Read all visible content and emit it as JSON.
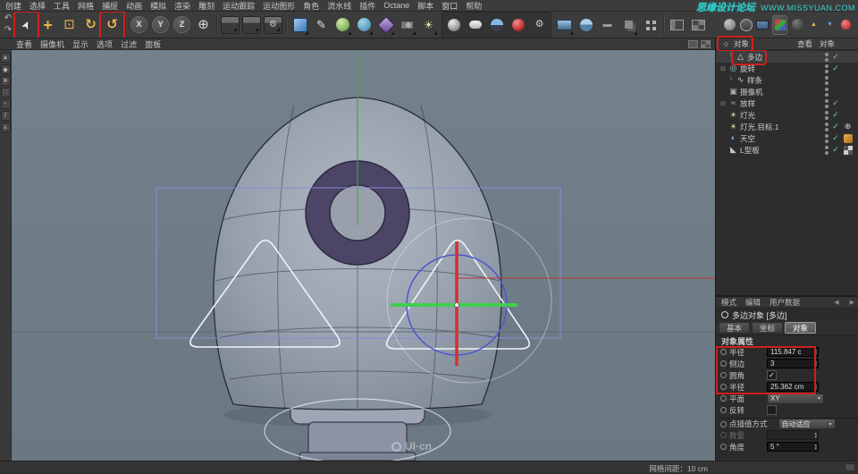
{
  "watermarks": {
    "forum": "思缘设计论坛",
    "url": "WWW.MISSYUAN.COM",
    "ui_logo": "UI·cn"
  },
  "menubar": {
    "items": [
      "创建",
      "选择",
      "工具",
      "网格",
      "捕捉",
      "动画",
      "模拟",
      "渲染",
      "雕刻",
      "运动跟踪",
      "运动图形",
      "角色",
      "流水线",
      "插件",
      "Octane",
      "脚本",
      "窗口",
      "帮助"
    ]
  },
  "toolbar": {
    "history": [
      {
        "n": "undo-icon"
      },
      {
        "n": "redo-icon"
      }
    ],
    "tools": [
      {
        "n": "live-selection-tool-icon",
        "boxed": true
      },
      {
        "n": "move-tool-icon"
      },
      {
        "n": "scale-tool-icon"
      },
      {
        "n": "rotate-tool-icon"
      },
      {
        "n": "last-used-tool-icon",
        "boxed": true
      }
    ],
    "axis": [
      {
        "n": "axis-x-button",
        "t": "X"
      },
      {
        "n": "axis-y-button",
        "t": "Y"
      },
      {
        "n": "axis-z-button",
        "t": "Z"
      },
      {
        "n": "coordinate-system-icon"
      }
    ],
    "render": [
      {
        "n": "render-view-icon"
      },
      {
        "n": "render-picture-viewer-icon"
      },
      {
        "n": "render-settings-icon"
      }
    ],
    "create": [
      {
        "n": "primitive-cube-icon"
      },
      {
        "n": "spline-pen-icon"
      },
      {
        "n": "subdivision-surface-icon"
      },
      {
        "n": "generator-icon"
      },
      {
        "n": "deformer-icon"
      },
      {
        "n": "camera-icon"
      },
      {
        "n": "light-icon"
      }
    ],
    "plugin": [
      {
        "n": "octane-liveviewer-icon"
      },
      {
        "n": "octane-material-icon"
      },
      {
        "n": "octane-environment-icon"
      },
      {
        "n": "octane-render-icon"
      },
      {
        "n": "octane-settings-icon"
      }
    ],
    "scene": [
      {
        "n": "floor-icon"
      },
      {
        "n": "sky-icon"
      },
      {
        "n": "stage-icon"
      },
      {
        "n": "instance-icon"
      },
      {
        "n": "array-icon"
      }
    ],
    "layout": [
      {
        "n": "single-layout-icon"
      },
      {
        "n": "quad-layout-icon"
      }
    ],
    "panel_icons": [
      {
        "n": "shaded-sphere-icon"
      },
      {
        "n": "wire-sphere-icon"
      },
      {
        "n": "grid-plane-icon"
      },
      {
        "n": "axis-colors-icon"
      },
      {
        "n": "dark-sphere-icon"
      },
      {
        "n": "arrow-up-icon",
        "t": "▲"
      },
      {
        "n": "arrow-down-icon",
        "t": "▼"
      },
      {
        "n": "red-close-icon"
      }
    ]
  },
  "viewport": {
    "menus": [
      "查看",
      "摄像机",
      "显示",
      "选项",
      "过滤",
      "面板"
    ],
    "layout_icons": [
      {
        "n": "single-view-icon"
      },
      {
        "n": "quad-view-icon"
      }
    ],
    "mode_icons": [
      {
        "n": "make-editable-icon"
      },
      {
        "n": "model-mode-icon"
      },
      {
        "n": "texture-mode-icon"
      },
      {
        "n": "workplane-mode-icon"
      },
      {
        "n": "points-mode-icon"
      },
      {
        "n": "edges-mode-icon"
      },
      {
        "n": "polygons-mode-icon"
      }
    ]
  },
  "object_manager": {
    "title": "对象",
    "menus": [
      "查看",
      "对象"
    ],
    "items": [
      {
        "name": "多边",
        "icon": "ngon-spline-icon",
        "indent": 1,
        "connector": true,
        "check": true,
        "boxed": true,
        "selected": true
      },
      {
        "name": "旋转",
        "icon": "lathe-icon",
        "indent": 0,
        "expand": true,
        "check": true
      },
      {
        "name": "样条",
        "icon": "spline-icon",
        "indent": 1,
        "connector": true,
        "check": false
      },
      {
        "name": "摄像机",
        "icon": "camera-object-icon",
        "indent": 0,
        "check": false
      },
      {
        "name": "放样",
        "icon": "loft-icon",
        "indent": 0,
        "expand": true,
        "check": true
      },
      {
        "name": "灯光",
        "icon": "light-object-icon",
        "indent": 0,
        "check": true
      },
      {
        "name": "灯光.目标.1",
        "icon": "light-object-icon",
        "indent": 0,
        "check": true,
        "tag": "target-tag-icon"
      },
      {
        "name": "天空",
        "icon": "sky-object-icon",
        "indent": 0,
        "check": true,
        "tag": "texture-tag-icon"
      },
      {
        "name": "L型板",
        "icon": "polygon-object-icon",
        "indent": 0,
        "check": true,
        "tag": "checker-tag-icon"
      }
    ]
  },
  "attributes": {
    "tabs": [
      "模式",
      "编辑",
      "用户数据"
    ],
    "title": "多边对象 [多边]",
    "subtabs": [
      "基本",
      "坐标",
      "对象"
    ],
    "active_subtab": "对象",
    "section": "对象属性",
    "props": [
      {
        "label": "半径",
        "type": "spinner",
        "value": "115.847 c"
      },
      {
        "label": "侧边",
        "type": "spinner",
        "value": "3"
      },
      {
        "label": "圆角",
        "type": "checkbox",
        "checked": true
      },
      {
        "label": "半径",
        "type": "spinner",
        "value": "25.362 cm"
      },
      {
        "label": "平面",
        "type": "dropdown",
        "value": "XY"
      },
      {
        "label": "反转",
        "type": "checkbox",
        "checked": false
      },
      {
        "label": "点插值方式",
        "type": "dropdown",
        "value": "自动适应",
        "wide": true
      },
      {
        "label": "数量",
        "type": "spinner",
        "value": "",
        "disabled": true
      },
      {
        "label": "角度",
        "type": "spinner",
        "value": "5 °"
      }
    ]
  },
  "statusbar": {
    "grid_spacing": "网格间距：10 cm"
  }
}
